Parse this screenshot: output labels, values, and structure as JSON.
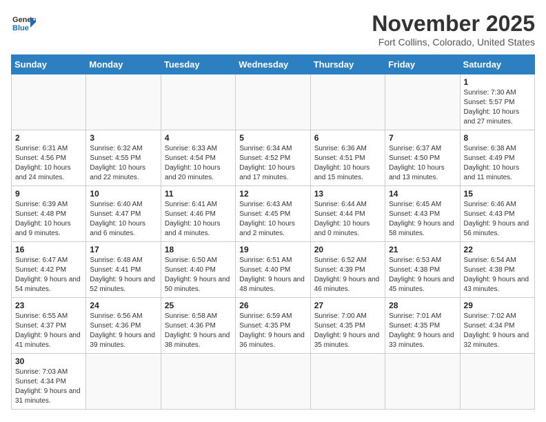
{
  "header": {
    "logo_general": "General",
    "logo_blue": "Blue",
    "month_title": "November 2025",
    "location": "Fort Collins, Colorado, United States"
  },
  "weekdays": [
    "Sunday",
    "Monday",
    "Tuesday",
    "Wednesday",
    "Thursday",
    "Friday",
    "Saturday"
  ],
  "weeks": [
    [
      {
        "day": "",
        "info": ""
      },
      {
        "day": "",
        "info": ""
      },
      {
        "day": "",
        "info": ""
      },
      {
        "day": "",
        "info": ""
      },
      {
        "day": "",
        "info": ""
      },
      {
        "day": "",
        "info": ""
      },
      {
        "day": "1",
        "info": "Sunrise: 7:30 AM\nSunset: 5:57 PM\nDaylight: 10 hours and 27 minutes."
      }
    ],
    [
      {
        "day": "2",
        "info": "Sunrise: 6:31 AM\nSunset: 4:56 PM\nDaylight: 10 hours and 24 minutes."
      },
      {
        "day": "3",
        "info": "Sunrise: 6:32 AM\nSunset: 4:55 PM\nDaylight: 10 hours and 22 minutes."
      },
      {
        "day": "4",
        "info": "Sunrise: 6:33 AM\nSunset: 4:54 PM\nDaylight: 10 hours and 20 minutes."
      },
      {
        "day": "5",
        "info": "Sunrise: 6:34 AM\nSunset: 4:52 PM\nDaylight: 10 hours and 17 minutes."
      },
      {
        "day": "6",
        "info": "Sunrise: 6:36 AM\nSunset: 4:51 PM\nDaylight: 10 hours and 15 minutes."
      },
      {
        "day": "7",
        "info": "Sunrise: 6:37 AM\nSunset: 4:50 PM\nDaylight: 10 hours and 13 minutes."
      },
      {
        "day": "8",
        "info": "Sunrise: 6:38 AM\nSunset: 4:49 PM\nDaylight: 10 hours and 11 minutes."
      }
    ],
    [
      {
        "day": "9",
        "info": "Sunrise: 6:39 AM\nSunset: 4:48 PM\nDaylight: 10 hours and 9 minutes."
      },
      {
        "day": "10",
        "info": "Sunrise: 6:40 AM\nSunset: 4:47 PM\nDaylight: 10 hours and 6 minutes."
      },
      {
        "day": "11",
        "info": "Sunrise: 6:41 AM\nSunset: 4:46 PM\nDaylight: 10 hours and 4 minutes."
      },
      {
        "day": "12",
        "info": "Sunrise: 6:43 AM\nSunset: 4:45 PM\nDaylight: 10 hours and 2 minutes."
      },
      {
        "day": "13",
        "info": "Sunrise: 6:44 AM\nSunset: 4:44 PM\nDaylight: 10 hours and 0 minutes."
      },
      {
        "day": "14",
        "info": "Sunrise: 6:45 AM\nSunset: 4:43 PM\nDaylight: 9 hours and 58 minutes."
      },
      {
        "day": "15",
        "info": "Sunrise: 6:46 AM\nSunset: 4:43 PM\nDaylight: 9 hours and 56 minutes."
      }
    ],
    [
      {
        "day": "16",
        "info": "Sunrise: 6:47 AM\nSunset: 4:42 PM\nDaylight: 9 hours and 54 minutes."
      },
      {
        "day": "17",
        "info": "Sunrise: 6:48 AM\nSunset: 4:41 PM\nDaylight: 9 hours and 52 minutes."
      },
      {
        "day": "18",
        "info": "Sunrise: 6:50 AM\nSunset: 4:40 PM\nDaylight: 9 hours and 50 minutes."
      },
      {
        "day": "19",
        "info": "Sunrise: 6:51 AM\nSunset: 4:40 PM\nDaylight: 9 hours and 48 minutes."
      },
      {
        "day": "20",
        "info": "Sunrise: 6:52 AM\nSunset: 4:39 PM\nDaylight: 9 hours and 46 minutes."
      },
      {
        "day": "21",
        "info": "Sunrise: 6:53 AM\nSunset: 4:38 PM\nDaylight: 9 hours and 45 minutes."
      },
      {
        "day": "22",
        "info": "Sunrise: 6:54 AM\nSunset: 4:38 PM\nDaylight: 9 hours and 43 minutes."
      }
    ],
    [
      {
        "day": "23",
        "info": "Sunrise: 6:55 AM\nSunset: 4:37 PM\nDaylight: 9 hours and 41 minutes."
      },
      {
        "day": "24",
        "info": "Sunrise: 6:56 AM\nSunset: 4:36 PM\nDaylight: 9 hours and 39 minutes."
      },
      {
        "day": "25",
        "info": "Sunrise: 6:58 AM\nSunset: 4:36 PM\nDaylight: 9 hours and 38 minutes."
      },
      {
        "day": "26",
        "info": "Sunrise: 6:59 AM\nSunset: 4:35 PM\nDaylight: 9 hours and 36 minutes."
      },
      {
        "day": "27",
        "info": "Sunrise: 7:00 AM\nSunset: 4:35 PM\nDaylight: 9 hours and 35 minutes."
      },
      {
        "day": "28",
        "info": "Sunrise: 7:01 AM\nSunset: 4:35 PM\nDaylight: 9 hours and 33 minutes."
      },
      {
        "day": "29",
        "info": "Sunrise: 7:02 AM\nSunset: 4:34 PM\nDaylight: 9 hours and 32 minutes."
      }
    ],
    [
      {
        "day": "30",
        "info": "Sunrise: 7:03 AM\nSunset: 4:34 PM\nDaylight: 9 hours and 31 minutes."
      },
      {
        "day": "",
        "info": ""
      },
      {
        "day": "",
        "info": ""
      },
      {
        "day": "",
        "info": ""
      },
      {
        "day": "",
        "info": ""
      },
      {
        "day": "",
        "info": ""
      },
      {
        "day": "",
        "info": ""
      }
    ]
  ]
}
